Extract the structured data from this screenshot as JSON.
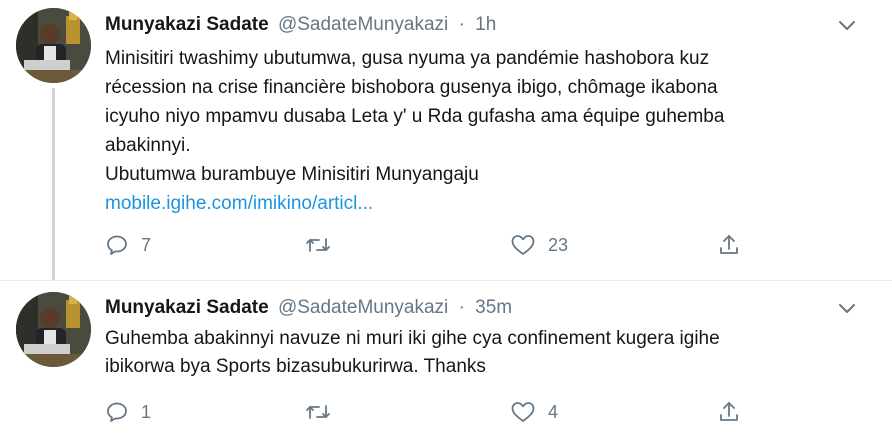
{
  "tweets": [
    {
      "author_name": "Munyakazi Sadate",
      "author_handle": "@SadateMunyakazi",
      "separator": "·",
      "time": "1h",
      "text_lines": [
        "Minisitiri twashimy ubutumwa, gusa nyuma ya pandémie hashobora kuz",
        "récession na crise financière bishobora gusenya ibigo, chômage ikabona",
        "icyuho niyo mpamvu dusaba Leta y' u Rda gufasha ama équipe guhemba",
        "abakinnyi.",
        "Ubutumwa burambuye Minisitiri Munyangaju"
      ],
      "link_text": "mobile.igihe.com/imikino/articl...",
      "reply_count": "7",
      "retweet_count": "",
      "like_count": "23"
    },
    {
      "author_name": "Munyakazi Sadate",
      "author_handle": "@SadateMunyakazi",
      "separator": "·",
      "time": "35m",
      "text_lines": [
        "Guhemba abakinnyi navuze ni muri iki gihe cya confinement kugera igihe",
        "ibikorwa bya Sports bizasubukurirwa. Thanks"
      ],
      "reply_count": "1",
      "retweet_count": "",
      "like_count": "4"
    }
  ],
  "icons": {
    "caret": "chevron-down-icon",
    "reply": "reply-icon",
    "retweet": "retweet-icon",
    "like": "heart-icon",
    "share": "share-icon"
  },
  "colors": {
    "link": "#1b95e0",
    "secondary_text": "#657786",
    "thread_line": "#ccd6dd",
    "icon": "#657786"
  }
}
